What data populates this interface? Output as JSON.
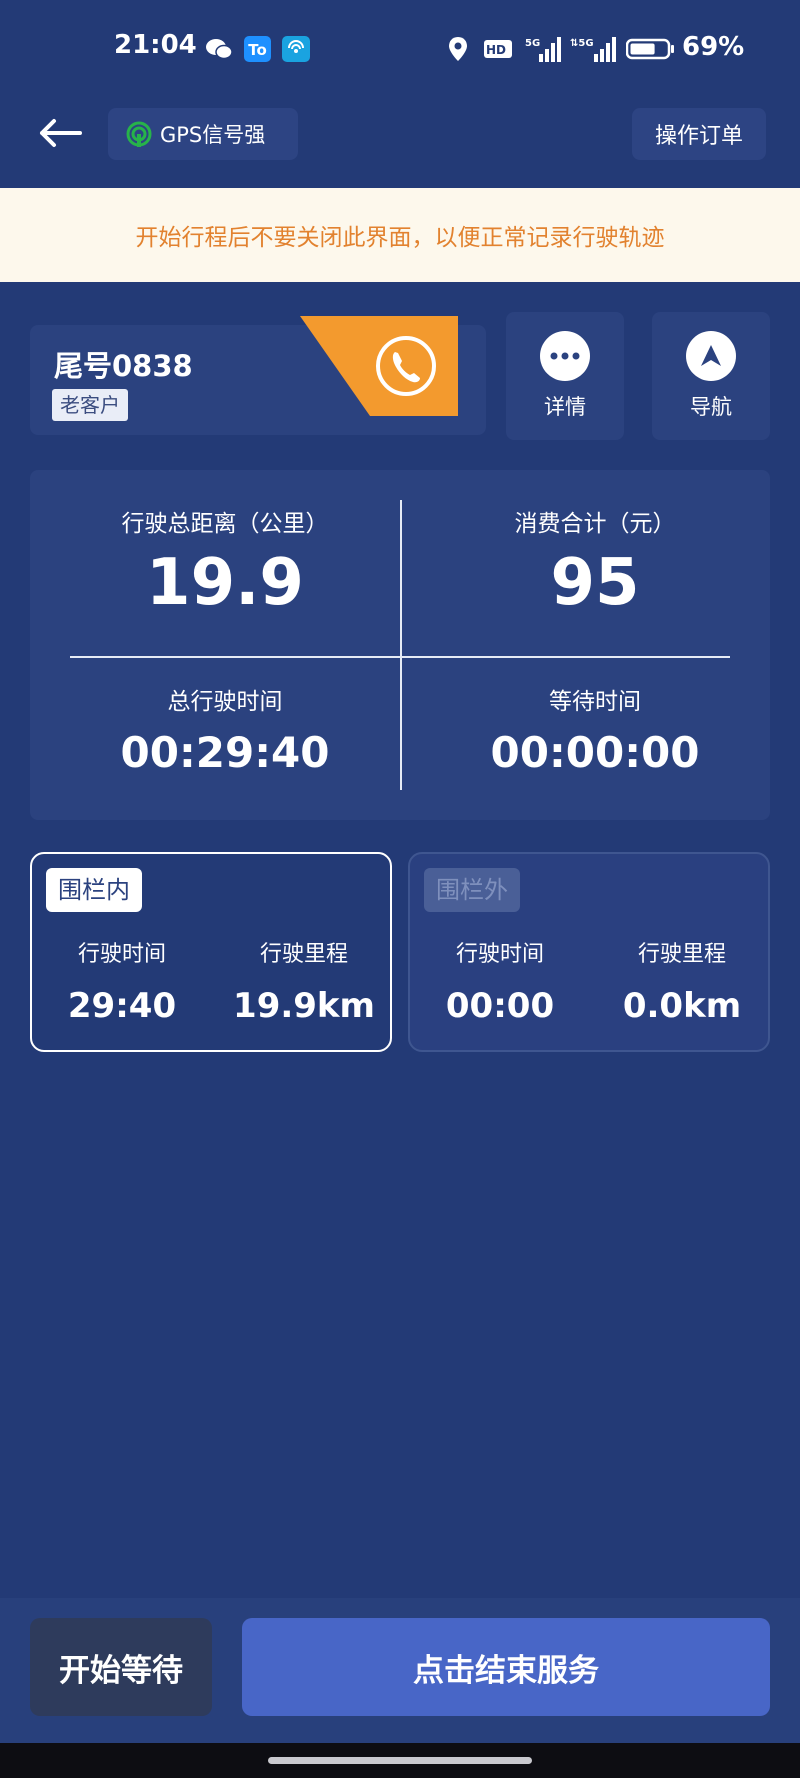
{
  "status_bar": {
    "time": "21:04",
    "battery_percent": "69%",
    "battery_level": 0.69,
    "icons": [
      "wechat-icon",
      "app-t-icon",
      "wifi-app-icon",
      "location-icon",
      "hd-icon",
      "signal-5g-icon",
      "signal-5g-2-icon",
      "battery-icon"
    ]
  },
  "header": {
    "gps_label": "GPS信号强",
    "operate_order_label": "操作订单"
  },
  "notice": {
    "text": "开始行程后不要关闭此界面，以便正常记录行驶轨迹"
  },
  "customer": {
    "tail_number": "尾号0838",
    "badge": "老客户"
  },
  "actions": {
    "details_label": "详情",
    "navigate_label": "导航"
  },
  "stats": {
    "distance_label": "行驶总距离（公里）",
    "distance_value": "19.9",
    "cost_label": "消费合计（元）",
    "cost_value": "95",
    "total_time_label": "总行驶时间",
    "total_time_value": "00:29:40",
    "wait_time_label": "等待时间",
    "wait_time_value": "00:00:00"
  },
  "fence_in": {
    "tag": "围栏内",
    "time_label": "行驶时间",
    "time_value": "29:40",
    "mileage_label": "行驶里程",
    "mileage_value": "19.9km"
  },
  "fence_out": {
    "tag": "围栏外",
    "time_label": "行驶时间",
    "time_value": "00:00",
    "mileage_label": "行驶里程",
    "mileage_value": "0.0km"
  },
  "bottom": {
    "start_wait_label": "开始等待",
    "end_service_label": "点击结束服务"
  },
  "colors": {
    "background": "#233a76",
    "card": "#2b427f",
    "accent_orange": "#f39a2e",
    "notice_text": "#e2822f",
    "gps_green": "#27b34a",
    "primary_button": "#4866c7"
  }
}
